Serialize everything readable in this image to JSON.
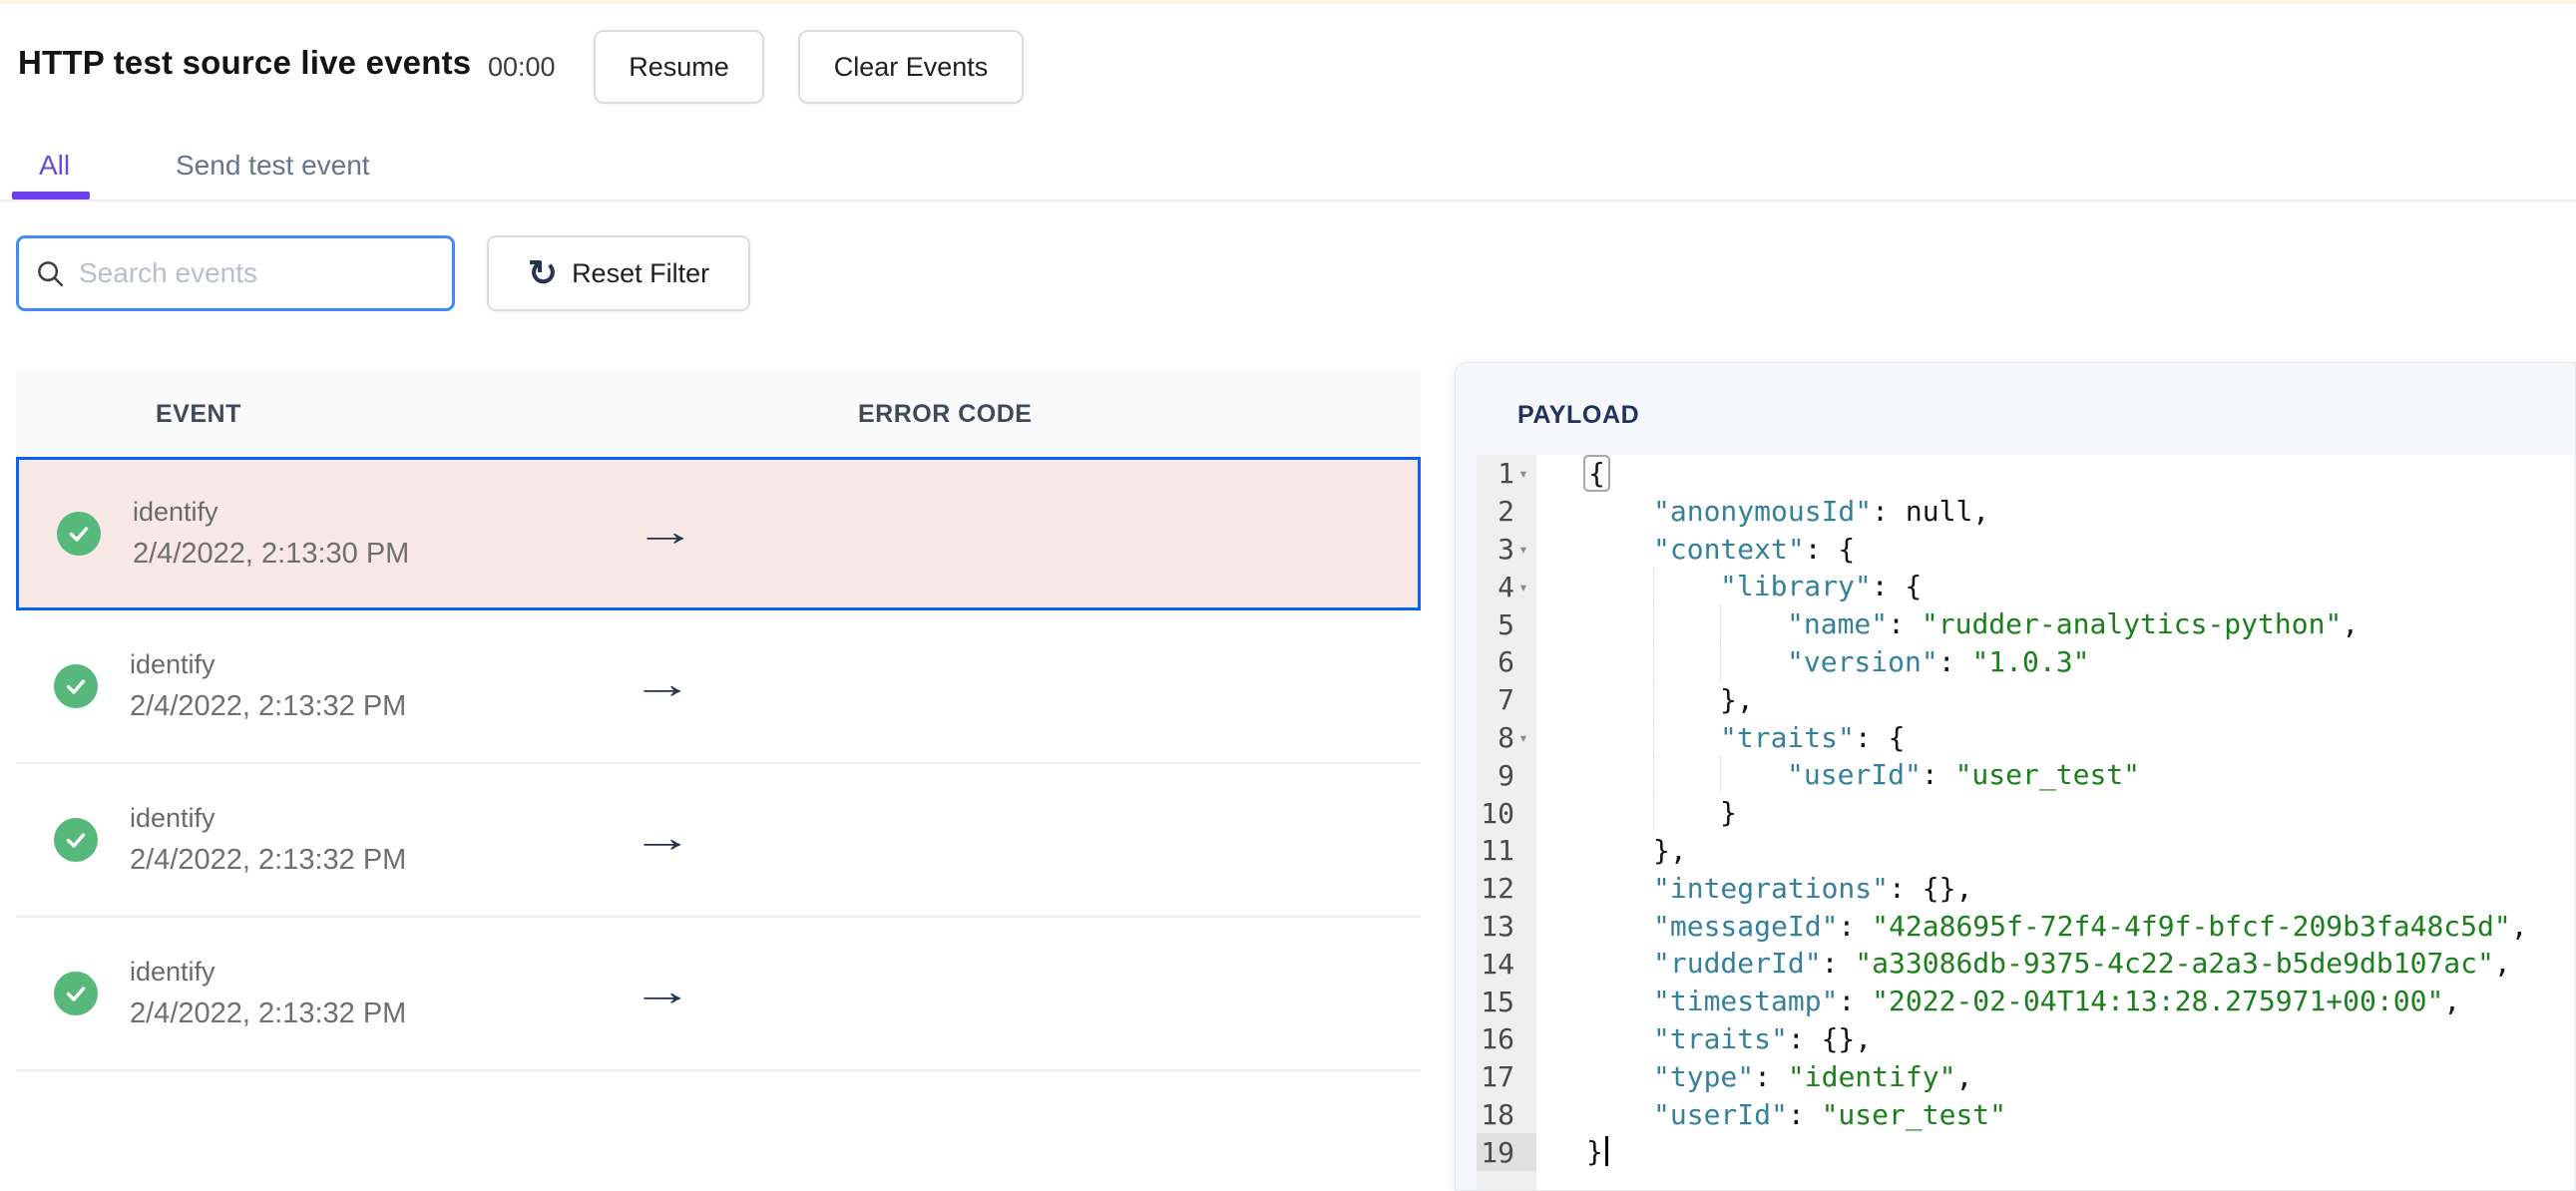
{
  "header": {
    "title": "HTTP test source live events",
    "timer": "00:00",
    "resume_label": "Resume",
    "clear_label": "Clear Events"
  },
  "tabs": {
    "all_label": "All",
    "send_label": "Send test event"
  },
  "filters": {
    "search_placeholder": "Search events",
    "search_value": "",
    "reset_label": "Reset Filter",
    "reset_icon": "↻",
    "search_icon": "magnifier"
  },
  "table": {
    "columns": [
      "EVENT",
      "ERROR CODE"
    ],
    "arrow_glyph": "→",
    "rows": [
      {
        "event": "identify",
        "time": "2/4/2022, 2:13:30 PM",
        "status": "success",
        "error_code": "",
        "selected": true
      },
      {
        "event": "identify",
        "time": "2/4/2022, 2:13:32 PM",
        "status": "success",
        "error_code": "",
        "selected": false
      },
      {
        "event": "identify",
        "time": "2/4/2022, 2:13:32 PM",
        "status": "success",
        "error_code": "",
        "selected": false
      },
      {
        "event": "identify",
        "time": "2/4/2022, 2:13:32 PM",
        "status": "success",
        "error_code": "",
        "selected": false
      }
    ]
  },
  "payload": {
    "title": "PAYLOAD",
    "fold_glyph": "▾",
    "lines": [
      {
        "num": 1,
        "fold": true,
        "indent": 0,
        "tokens": [
          {
            "t": "b",
            "v": "{"
          }
        ]
      },
      {
        "num": 2,
        "fold": false,
        "indent": 1,
        "tokens": [
          {
            "t": "k",
            "v": "\"anonymousId\""
          },
          {
            "t": "p",
            "v": ": null,"
          }
        ]
      },
      {
        "num": 3,
        "fold": true,
        "indent": 1,
        "tokens": [
          {
            "t": "k",
            "v": "\"context\""
          },
          {
            "t": "p",
            "v": ": {"
          }
        ]
      },
      {
        "num": 4,
        "fold": true,
        "indent": 2,
        "tokens": [
          {
            "t": "k",
            "v": "\"library\""
          },
          {
            "t": "p",
            "v": ": {"
          }
        ]
      },
      {
        "num": 5,
        "fold": false,
        "indent": 3,
        "tokens": [
          {
            "t": "k",
            "v": "\"name\""
          },
          {
            "t": "p",
            "v": ": "
          },
          {
            "t": "s",
            "v": "\"rudder-analytics-python\""
          },
          {
            "t": "p",
            "v": ","
          }
        ]
      },
      {
        "num": 6,
        "fold": false,
        "indent": 3,
        "tokens": [
          {
            "t": "k",
            "v": "\"version\""
          },
          {
            "t": "p",
            "v": ": "
          },
          {
            "t": "s",
            "v": "\"1.0.3\""
          }
        ]
      },
      {
        "num": 7,
        "fold": false,
        "indent": 2,
        "tokens": [
          {
            "t": "p",
            "v": "},"
          }
        ]
      },
      {
        "num": 8,
        "fold": true,
        "indent": 2,
        "tokens": [
          {
            "t": "k",
            "v": "\"traits\""
          },
          {
            "t": "p",
            "v": ": {"
          }
        ]
      },
      {
        "num": 9,
        "fold": false,
        "indent": 3,
        "tokens": [
          {
            "t": "k",
            "v": "\"userId\""
          },
          {
            "t": "p",
            "v": ": "
          },
          {
            "t": "s",
            "v": "\"user_test\""
          }
        ]
      },
      {
        "num": 10,
        "fold": false,
        "indent": 2,
        "tokens": [
          {
            "t": "p",
            "v": "}"
          }
        ]
      },
      {
        "num": 11,
        "fold": false,
        "indent": 1,
        "tokens": [
          {
            "t": "p",
            "v": "},"
          }
        ]
      },
      {
        "num": 12,
        "fold": false,
        "indent": 1,
        "tokens": [
          {
            "t": "k",
            "v": "\"integrations\""
          },
          {
            "t": "p",
            "v": ": {},"
          }
        ]
      },
      {
        "num": 13,
        "fold": false,
        "indent": 1,
        "tokens": [
          {
            "t": "k",
            "v": "\"messageId\""
          },
          {
            "t": "p",
            "v": ": "
          },
          {
            "t": "s",
            "v": "\"42a8695f-72f4-4f9f-bfcf-209b3fa48c5d\""
          },
          {
            "t": "p",
            "v": ","
          }
        ]
      },
      {
        "num": 14,
        "fold": false,
        "indent": 1,
        "tokens": [
          {
            "t": "k",
            "v": "\"rudderId\""
          },
          {
            "t": "p",
            "v": ": "
          },
          {
            "t": "s",
            "v": "\"a33086db-9375-4c22-a2a3-b5de9db107ac\""
          },
          {
            "t": "p",
            "v": ","
          }
        ]
      },
      {
        "num": 15,
        "fold": false,
        "indent": 1,
        "tokens": [
          {
            "t": "k",
            "v": "\"timestamp\""
          },
          {
            "t": "p",
            "v": ": "
          },
          {
            "t": "s",
            "v": "\"2022-02-04T14:13:28.275971+00:00\""
          },
          {
            "t": "p",
            "v": ","
          }
        ]
      },
      {
        "num": 16,
        "fold": false,
        "indent": 1,
        "tokens": [
          {
            "t": "k",
            "v": "\"traits\""
          },
          {
            "t": "p",
            "v": ": {},"
          }
        ]
      },
      {
        "num": 17,
        "fold": false,
        "indent": 1,
        "tokens": [
          {
            "t": "k",
            "v": "\"type\""
          },
          {
            "t": "p",
            "v": ": "
          },
          {
            "t": "s",
            "v": "\"identify\""
          },
          {
            "t": "p",
            "v": ","
          }
        ]
      },
      {
        "num": 18,
        "fold": false,
        "indent": 1,
        "tokens": [
          {
            "t": "k",
            "v": "\"userId\""
          },
          {
            "t": "p",
            "v": ": "
          },
          {
            "t": "s",
            "v": "\"user_test\""
          }
        ]
      },
      {
        "num": 19,
        "fold": false,
        "indent": 0,
        "active": true,
        "cursor": true,
        "tokens": [
          {
            "t": "p",
            "v": "}"
          }
        ]
      }
    ]
  },
  "colors": {
    "accent_purple": "#6a4be0",
    "ink_bar": "#6d3fe6",
    "selected_blue": "#0b63f3",
    "selected_row_bg": "#f8e8e6",
    "success_green": "#56b87b",
    "key_teal": "#35809b",
    "string_green": "#1b7f1b",
    "panel_bg": "#f6f7fa",
    "cream_top": "#fbf5e4"
  }
}
